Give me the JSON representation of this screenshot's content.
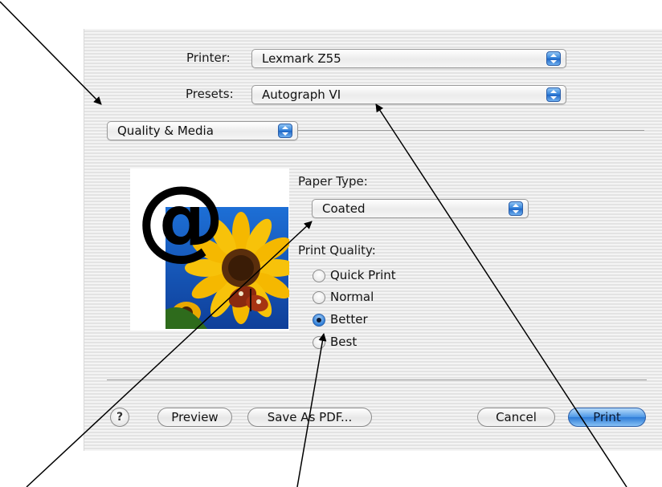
{
  "printer": {
    "label": "Printer:",
    "value": "Lexmark Z55"
  },
  "presets": {
    "label": "Presets:",
    "value": "Autograph VI"
  },
  "panel_select": {
    "value": "Quality & Media"
  },
  "paper_type": {
    "label": "Paper Type:",
    "value": "Coated"
  },
  "print_quality": {
    "label": "Print Quality:",
    "options": [
      "Quick Print",
      "Normal",
      "Better",
      "Best"
    ],
    "selected": "Better"
  },
  "buttons": {
    "help": "?",
    "preview": "Preview",
    "save_pdf": "Save As PDF...",
    "cancel": "Cancel",
    "print": "Print"
  },
  "image": {
    "logo_text": "@"
  },
  "colors": {
    "accent": "#2f7fd8",
    "arrow": "#000000"
  }
}
